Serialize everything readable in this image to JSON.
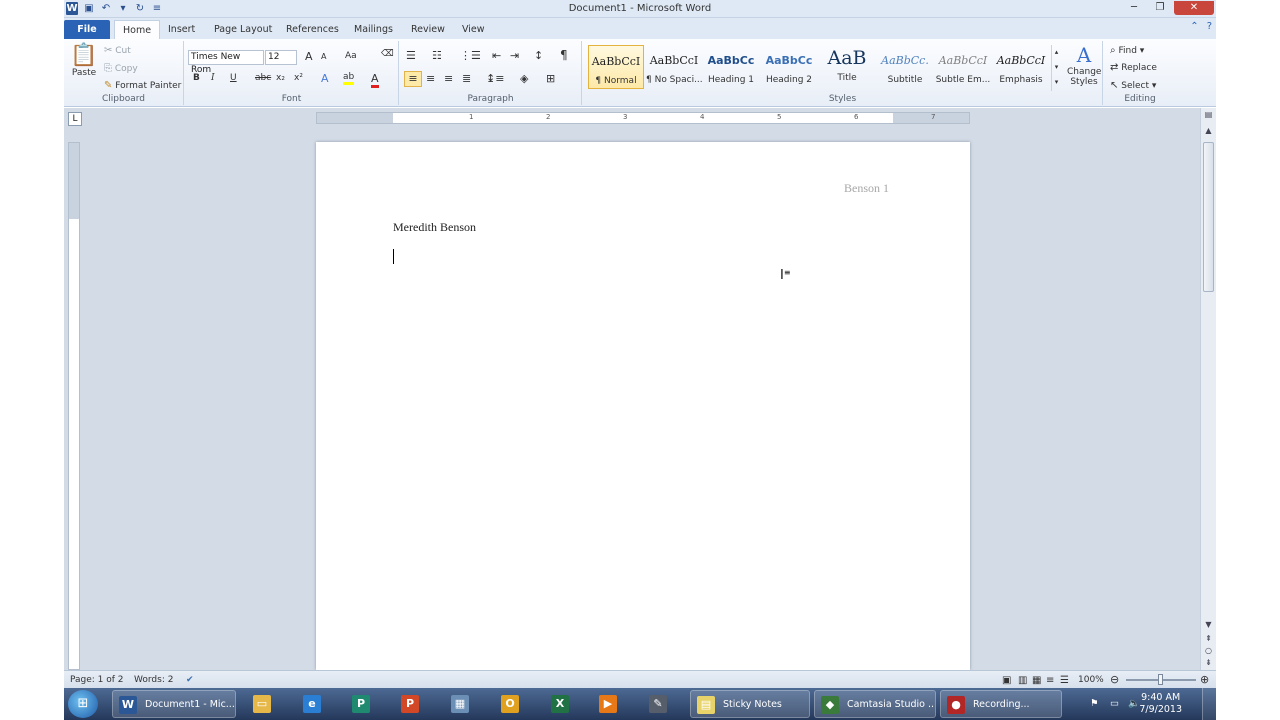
{
  "window": {
    "title": "Document1 - Microsoft Word"
  },
  "qat": {
    "app_icon": "W"
  },
  "tabs": [
    "File",
    "Home",
    "Insert",
    "Page Layout",
    "References",
    "Mailings",
    "Review",
    "View"
  ],
  "clipboard": {
    "paste": "Paste",
    "cut": "Cut",
    "copy": "Copy",
    "format_painter": "Format Painter",
    "label": "Clipboard"
  },
  "font": {
    "name": "Times New Rom",
    "size": "12",
    "label": "Font",
    "bold": "B",
    "italic": "I",
    "underline": "U",
    "strike": "abc",
    "sub": "x₂",
    "sup": "x²",
    "grow": "A",
    "shrink": "A",
    "case": "Aa"
  },
  "paragraph": {
    "label": "Paragraph",
    "pilcrow": "¶"
  },
  "styles": {
    "label": "Styles",
    "items": [
      {
        "preview": "AaBbCcI",
        "name": "¶ Normal"
      },
      {
        "preview": "AaBbCcI",
        "name": "¶ No Spaci..."
      },
      {
        "preview": "AaBbCc",
        "name": "Heading 1"
      },
      {
        "preview": "AaBbCc",
        "name": "Heading 2"
      },
      {
        "preview": "AaB",
        "name": "Title"
      },
      {
        "preview": "AaBbCc.",
        "name": "Subtitle"
      },
      {
        "preview": "AaBbCcI",
        "name": "Subtle Em..."
      },
      {
        "preview": "AaBbCcI",
        "name": "Emphasis"
      }
    ],
    "change_styles_1": "Change",
    "change_styles_2": "Styles"
  },
  "editing": {
    "label": "Editing",
    "find": "Find",
    "replace": "Replace",
    "select": "Select"
  },
  "ruler": {
    "numbers": [
      "1",
      "2",
      "3",
      "4",
      "5",
      "6",
      "7"
    ],
    "box": "L"
  },
  "document": {
    "header": "Benson 1",
    "name_line": "Meredith Benson"
  },
  "status": {
    "page": "Page: 1 of 2",
    "words": "Words: 2",
    "zoom": "100%"
  },
  "taskbar": {
    "items": [
      {
        "label": "Document1 - Mic...",
        "icon": "W",
        "color": "#2b5797"
      },
      {
        "label": "Sticky Notes",
        "icon": "▤",
        "color": "#e8d36a"
      },
      {
        "label": "Camtasia Studio ...",
        "icon": "◆",
        "color": "#3a7a3a"
      },
      {
        "label": "Recording...",
        "icon": "●",
        "color": "#b32626"
      }
    ],
    "pinned": [
      "▭",
      "e",
      "P",
      "P",
      "▦",
      "O",
      "X",
      "▶",
      "✎"
    ],
    "clock_time": "9:40 AM",
    "clock_date": "7/9/2013"
  }
}
